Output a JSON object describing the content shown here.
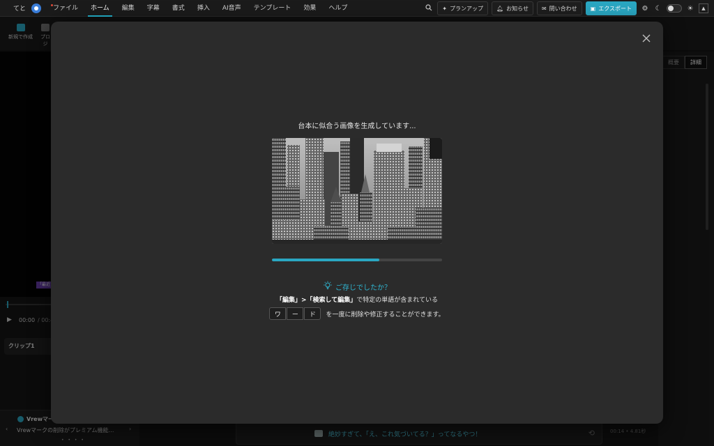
{
  "topbar": {
    "user_name": "てと",
    "menu": [
      "ファイル",
      "ホーム",
      "編集",
      "字幕",
      "書式",
      "挿入",
      "AI音声",
      "テンプレート",
      "効果",
      "ヘルプ"
    ],
    "plan_up": "プランアップ",
    "notifications": "お知らせ",
    "contact": "問い合わせ",
    "export": "エクスポート"
  },
  "toolbar": {
    "new_create": "新規で作成",
    "project": "プロジ"
  },
  "preview": {
    "badge": "「最近",
    "time_current": "00:00",
    "time_total": "/ 00:4"
  },
  "clip": {
    "label": "クリップ1"
  },
  "notice": {
    "title": "Vrewマー",
    "body": "Vrewマークの削除がプレミアム機能…",
    "dots": "• • • •"
  },
  "right_panel": {
    "tab_summary": "概要",
    "tab_detail": "詳細"
  },
  "caption": {
    "text": "絶妙すぎて、「え、これ気づいてる？」ってなるやつ！"
  },
  "time_info": "00:14 • 4.81秒",
  "modal": {
    "title": "台本に似合う画像を生成しています...",
    "progress": 0.63,
    "tip_title": "ご存じでしたか？",
    "tip_line1_prefix": "「編集」>「検索して編集」",
    "tip_line1_suffix": "で特定の単語が含まれている",
    "tip_chips": [
      "ワ",
      "ー",
      "ド"
    ],
    "tip_line2_suffix": "を一度に削除や修正することができます。"
  },
  "colors": {
    "accent": "#2aa7c2",
    "modal_bg": "#2b2b2b"
  }
}
